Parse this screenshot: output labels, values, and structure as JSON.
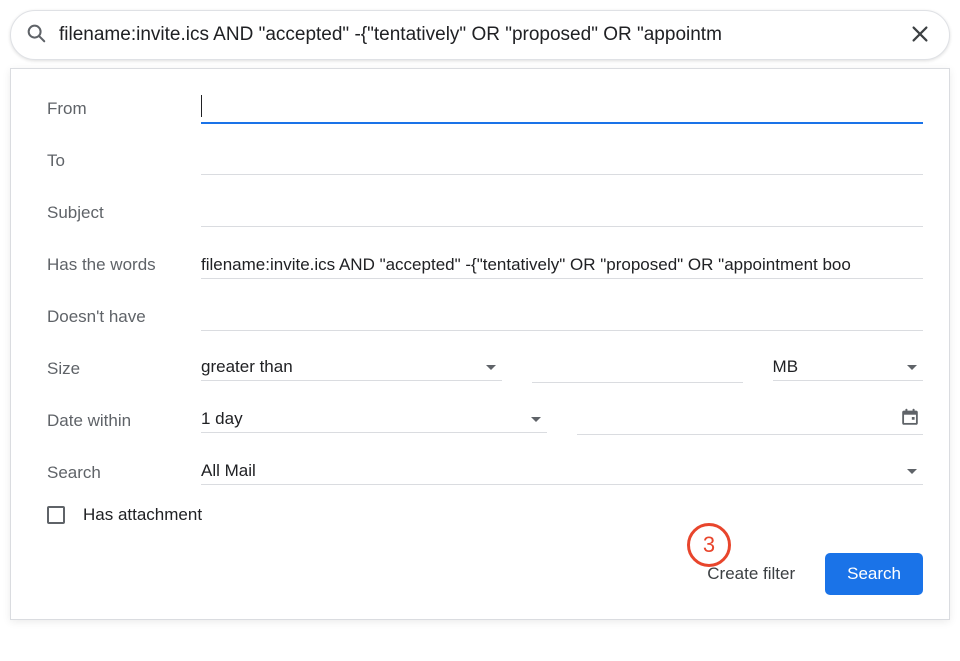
{
  "search": {
    "query": "filename:invite.ics AND \"accepted\" -{\"tentatively\" OR \"proposed\" OR \"appointm"
  },
  "filter": {
    "labels": {
      "from": "From",
      "to": "To",
      "subject": "Subject",
      "has_words": "Has the words",
      "doesnt_have": "Doesn't have",
      "size": "Size",
      "date_within": "Date within",
      "search": "Search",
      "has_attachment": "Has attachment"
    },
    "values": {
      "from": "",
      "to": "",
      "subject": "",
      "has_words": "filename:invite.ics AND \"accepted\" -{\"tentatively\" OR \"proposed\" OR \"appointment boo",
      "doesnt_have": "",
      "size_comparator": "greater than",
      "size_amount": "",
      "size_unit": "MB",
      "date_range": "1 day",
      "date_value": "",
      "search_scope": "All Mail",
      "has_attachment_checked": false
    }
  },
  "actions": {
    "create_filter": "Create filter",
    "search_button": "Search"
  },
  "annotation": {
    "step": "3"
  }
}
